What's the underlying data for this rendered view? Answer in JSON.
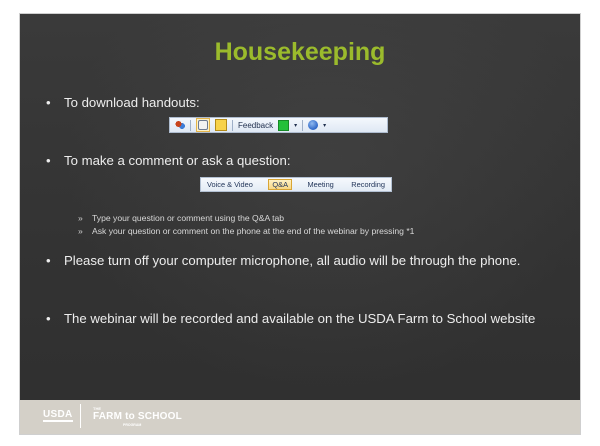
{
  "slide": {
    "title": "Housekeeping",
    "bullets": [
      "To download handouts:",
      "To make a comment or ask a question:",
      "Please turn off your computer microphone, all audio will be through the phone.",
      "The webinar will be recorded and available on the USDA Farm to School website"
    ],
    "sub_bullets": [
      "Type your question or comment using the Q&A tab",
      "Ask your question or comment on the phone at the end of the webinar by pressing *1"
    ],
    "bullet_glyph": "•",
    "sub_glyph": "»"
  },
  "toolbar1": {
    "feedback_label": "Feedback",
    "caret": "▾",
    "icons": [
      "people-icon",
      "hand-icon",
      "note-icon",
      "status-green-icon",
      "help-icon"
    ]
  },
  "toolbar2": {
    "tabs": [
      "Voice & Video",
      "Q&A",
      "Meeting",
      "Recording"
    ],
    "active_tab": "Q&A"
  },
  "footer": {
    "usda": "USDA",
    "f2s_small": "THE",
    "f2s": "FARM to SCHOOL",
    "f2s_program": "PROGRAM"
  },
  "colors": {
    "title": "#9bbb2c",
    "background": "#333333",
    "footer": "#d4d0c8"
  }
}
